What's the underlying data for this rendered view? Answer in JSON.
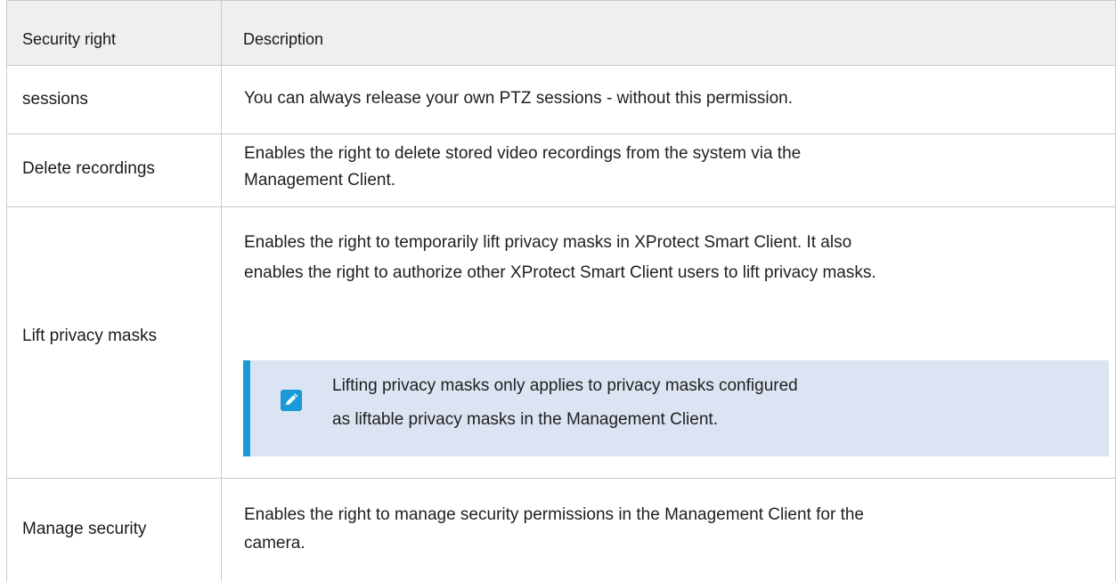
{
  "header": {
    "col1": "Security right",
    "col2": "Description"
  },
  "rows": [
    {
      "right": "sessions",
      "description": "You can always release your own PTZ sessions - without this permission."
    },
    {
      "right": "Delete recordings",
      "description_line1": "Enables the right to delete stored video recordings from the system via the",
      "description_line2": "Management Client."
    },
    {
      "right": "Lift privacy masks",
      "description_line1": "Enables the right to temporarily lift privacy masks in XProtect Smart Client. It also",
      "description_line2": "enables the right to authorize other XProtect Smart Client users to lift privacy masks.",
      "note_line1": "Lifting privacy masks only applies to privacy masks configured",
      "note_line2": "as liftable privacy masks in the Management Client.",
      "note_icon": "pencil-icon"
    },
    {
      "right": "Manage security",
      "description_line1": "Enables the right to manage security permissions in the Management Client for the",
      "description_line2": "camera."
    }
  ],
  "colors": {
    "header_bg": "#efefef",
    "note_bg": "#dbe4f2",
    "accent": "#1a9ad6"
  }
}
